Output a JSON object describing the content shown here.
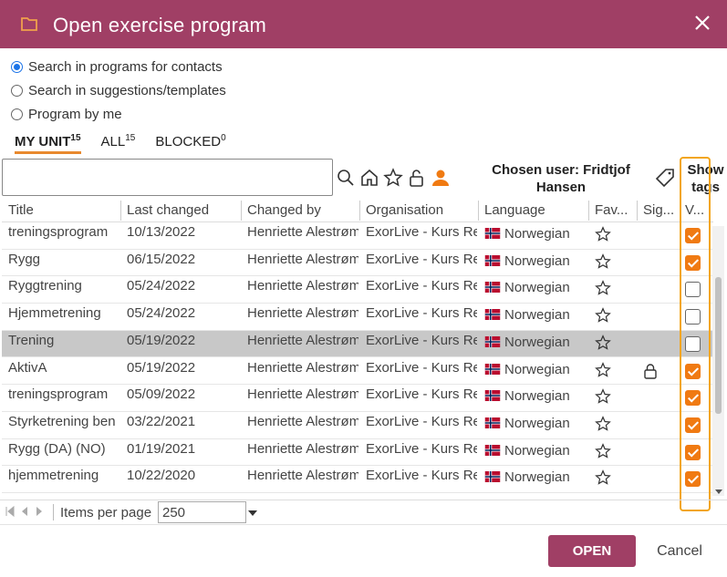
{
  "dialog": {
    "title": "Open exercise program",
    "folder_icon": "folder-icon",
    "close_icon": "close-icon"
  },
  "radios": [
    {
      "label": "Search in programs for contacts",
      "checked": true
    },
    {
      "label": "Search in suggestions/templates",
      "checked": false
    },
    {
      "label": "Program by me",
      "checked": false
    }
  ],
  "tabs": [
    {
      "label": "MY UNIT",
      "count": "15",
      "active": true
    },
    {
      "label": "ALL",
      "count": "15",
      "active": false
    },
    {
      "label": "BLOCKED",
      "count": "0",
      "active": false
    }
  ],
  "search": {
    "value": "",
    "placeholder": ""
  },
  "toolbar_icons": [
    "search-icon",
    "home-icon",
    "star-icon",
    "unlock-icon",
    "person-icon"
  ],
  "chosen_user": {
    "line1": "Chosen user: Fridtjof",
    "line2": "Hansen"
  },
  "show_tags": {
    "line1": "Show",
    "line2": "tags"
  },
  "columns": [
    "Title",
    "Last changed",
    "Changed by",
    "Organisation",
    "Language",
    "Fav...",
    "Sig...",
    "V..."
  ],
  "rows": [
    {
      "title": "treningsprogram",
      "date": "10/13/2022",
      "by": "Henriette Alestrøm",
      "org": "ExorLive - Kurs Re",
      "lang": "Norwegian",
      "locked": false,
      "checked": true,
      "selected": false
    },
    {
      "title": "Rygg",
      "date": "06/15/2022",
      "by": "Henriette Alestrøm",
      "org": "ExorLive - Kurs Re",
      "lang": "Norwegian",
      "locked": false,
      "checked": true,
      "selected": false
    },
    {
      "title": "Ryggtrening",
      "date": "05/24/2022",
      "by": "Henriette Alestrøm",
      "org": "ExorLive - Kurs Re",
      "lang": "Norwegian",
      "locked": false,
      "checked": false,
      "selected": false
    },
    {
      "title": "Hjemmetrening",
      "date": "05/24/2022",
      "by": "Henriette Alestrøm",
      "org": "ExorLive - Kurs Re",
      "lang": "Norwegian",
      "locked": false,
      "checked": false,
      "selected": false
    },
    {
      "title": "Trening",
      "date": "05/19/2022",
      "by": "Henriette Alestrøm",
      "org": "ExorLive - Kurs Re",
      "lang": "Norwegian",
      "locked": false,
      "checked": false,
      "selected": true
    },
    {
      "title": "AktivA",
      "date": "05/19/2022",
      "by": "Henriette Alestrøm",
      "org": "ExorLive - Kurs Re",
      "lang": "Norwegian",
      "locked": true,
      "checked": true,
      "selected": false
    },
    {
      "title": "treningsprogram",
      "date": "05/09/2022",
      "by": "Henriette Alestrøm",
      "org": "ExorLive - Kurs Re",
      "lang": "Norwegian",
      "locked": false,
      "checked": true,
      "selected": false
    },
    {
      "title": "Styrketrening ben",
      "date": "03/22/2021",
      "by": "Henriette Alestrøm",
      "org": "ExorLive - Kurs Re",
      "lang": "Norwegian",
      "locked": false,
      "checked": true,
      "selected": false
    },
    {
      "title": "Rygg (DA) (NO)",
      "date": "01/19/2021",
      "by": "Henriette Alestrøm",
      "org": "ExorLive - Kurs Re",
      "lang": "Norwegian",
      "locked": false,
      "checked": true,
      "selected": false
    },
    {
      "title": "hjemmetrening",
      "date": "10/22/2020",
      "by": "Henriette Alestrøm",
      "org": "ExorLive - Kurs Re",
      "lang": "Norwegian",
      "locked": false,
      "checked": true,
      "selected": false
    }
  ],
  "pager": {
    "items_per_page_label": "Items per page",
    "items_per_page": "250"
  },
  "footer": {
    "open_label": "OPEN",
    "cancel_label": "Cancel"
  },
  "colors": {
    "accent": "#a03f65",
    "checkbox": "#f07a12",
    "highlight": "#f2a51a",
    "tab_underline": "#e8892e"
  }
}
